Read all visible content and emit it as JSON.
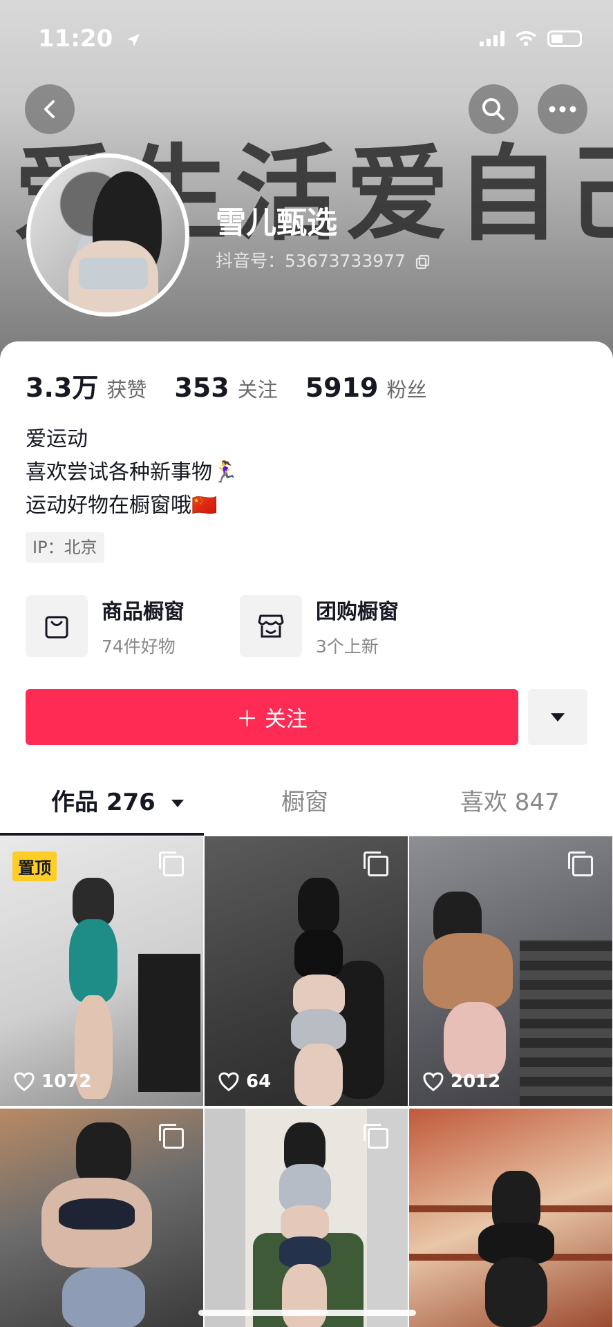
{
  "status": {
    "time": "11:20"
  },
  "header": {
    "banner_text": "爱生活爱自己",
    "username": "雪儿甄选",
    "douyin_id": "抖音号：53673733977"
  },
  "stats": [
    {
      "value": "3.3万",
      "label": "获赞"
    },
    {
      "value": "353",
      "label": "关注"
    },
    {
      "value": "5919",
      "label": "粉丝"
    }
  ],
  "bio": {
    "lines": [
      "爱运动",
      "喜欢尝试各种新事物🏃‍♀️",
      "运动好物在橱窗哦🇨🇳"
    ],
    "ip": "IP：北京"
  },
  "shops": [
    {
      "title": "商品橱窗",
      "subtitle": "74件好物",
      "icon": "shopping-bag-icon"
    },
    {
      "title": "团购橱窗",
      "subtitle": "3个上新",
      "icon": "storefront-icon"
    }
  ],
  "actions": {
    "follow_label": "＋ 关注"
  },
  "tabs": [
    {
      "label": "作品 276",
      "active": true
    },
    {
      "label": "橱窗",
      "active": false
    },
    {
      "label": "喜欢 847",
      "active": false
    }
  ],
  "videos": [
    {
      "likes": "1072",
      "pinned_label": "置顶",
      "multi": true
    },
    {
      "likes": "64",
      "multi": true
    },
    {
      "likes": "2012",
      "multi": true
    },
    {
      "likes": "",
      "multi": true
    },
    {
      "likes": "",
      "multi": true
    },
    {
      "likes": "",
      "multi": false
    }
  ],
  "colors": {
    "accent": "#fe2c55",
    "pin": "#fece26"
  }
}
